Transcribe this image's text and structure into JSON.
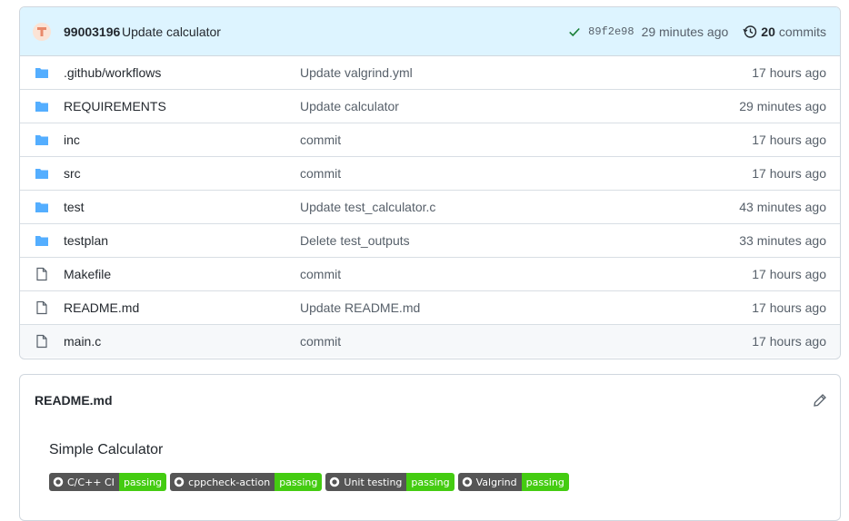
{
  "commit": {
    "author": "99003196",
    "message": "Update calculator",
    "sha": "89f2e98",
    "time": "29 minutes ago",
    "count": "20",
    "count_label": "commits"
  },
  "files": [
    {
      "name": ".github/workflows",
      "type": "folder",
      "message": "Update valgrind.yml",
      "age": "17 hours ago"
    },
    {
      "name": "REQUIREMENTS",
      "type": "folder",
      "message": "Update calculator",
      "age": "29 minutes ago"
    },
    {
      "name": "inc",
      "type": "folder",
      "message": "commit",
      "age": "17 hours ago"
    },
    {
      "name": "src",
      "type": "folder",
      "message": "commit",
      "age": "17 hours ago"
    },
    {
      "name": "test",
      "type": "folder",
      "message": "Update test_calculator.c",
      "age": "43 minutes ago"
    },
    {
      "name": "testplan",
      "type": "folder",
      "message": "Delete test_outputs",
      "age": "33 minutes ago"
    },
    {
      "name": "Makefile",
      "type": "file",
      "message": "commit",
      "age": "17 hours ago"
    },
    {
      "name": "README.md",
      "type": "file",
      "message": "Update README.md",
      "age": "17 hours ago"
    },
    {
      "name": "main.c",
      "type": "file",
      "message": "commit",
      "age": "17 hours ago"
    }
  ],
  "readme": {
    "title": "README.md",
    "heading": "Simple Calculator",
    "badges": [
      {
        "label": "C/C++ CI",
        "status": "passing"
      },
      {
        "label": "cppcheck-action",
        "status": "passing"
      },
      {
        "label": "Unit testing",
        "status": "passing"
      },
      {
        "label": "Valgrind",
        "status": "passing"
      }
    ]
  },
  "colors": {
    "folder": "#54aeff",
    "commit_bar_bg": "#ddf4ff",
    "badge_pass": "#44cc11",
    "check": "#1a7f37"
  }
}
